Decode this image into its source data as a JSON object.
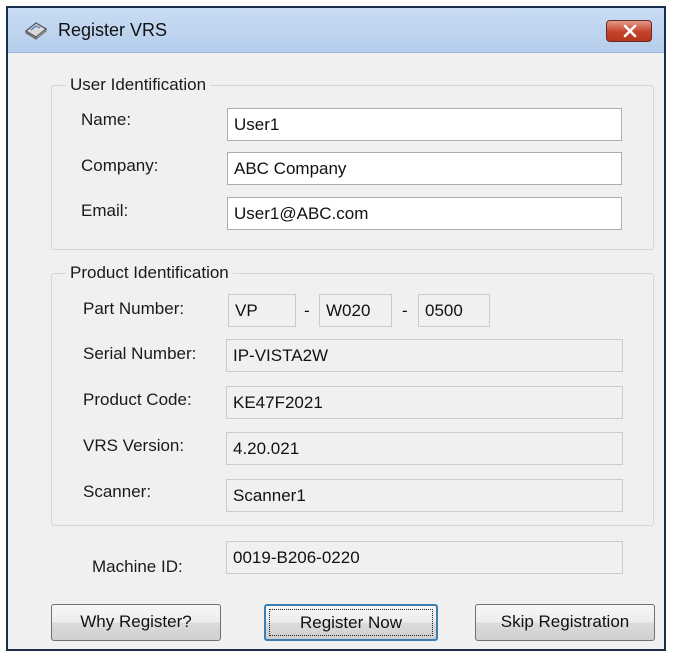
{
  "window": {
    "title": "Register VRS"
  },
  "user_identification": {
    "legend": "User Identification",
    "name": {
      "label": "Name:",
      "value": "User1"
    },
    "company": {
      "label": "Company:",
      "value": "ABC Company"
    },
    "email": {
      "label": "Email:",
      "value": "User1@ABC.com"
    }
  },
  "product_identification": {
    "legend": "Product Identification",
    "part_number": {
      "label": "Part Number:",
      "segments": [
        "VP",
        "W020",
        "0500"
      ],
      "separator": "-"
    },
    "serial_number": {
      "label": "Serial Number:",
      "value": "IP-VISTA2W"
    },
    "product_code": {
      "label": "Product Code:",
      "value": "KE47F2021"
    },
    "vrs_version": {
      "label": "VRS Version:",
      "value": "4.20.021"
    },
    "scanner": {
      "label": "Scanner:",
      "value": "Scanner1"
    }
  },
  "machine_id": {
    "label": "Machine ID:",
    "value": "0019-B206-0220"
  },
  "buttons": {
    "why_register": "Why Register?",
    "register_now": "Register Now",
    "skip_registration": "Skip Registration"
  },
  "icons": {
    "app": "scanner-app-icon",
    "close": "close-icon"
  },
  "colors": {
    "titlebar": "#c9dcf3",
    "close_button": "#c5422b",
    "dialog_bg": "#f0f0f0"
  }
}
